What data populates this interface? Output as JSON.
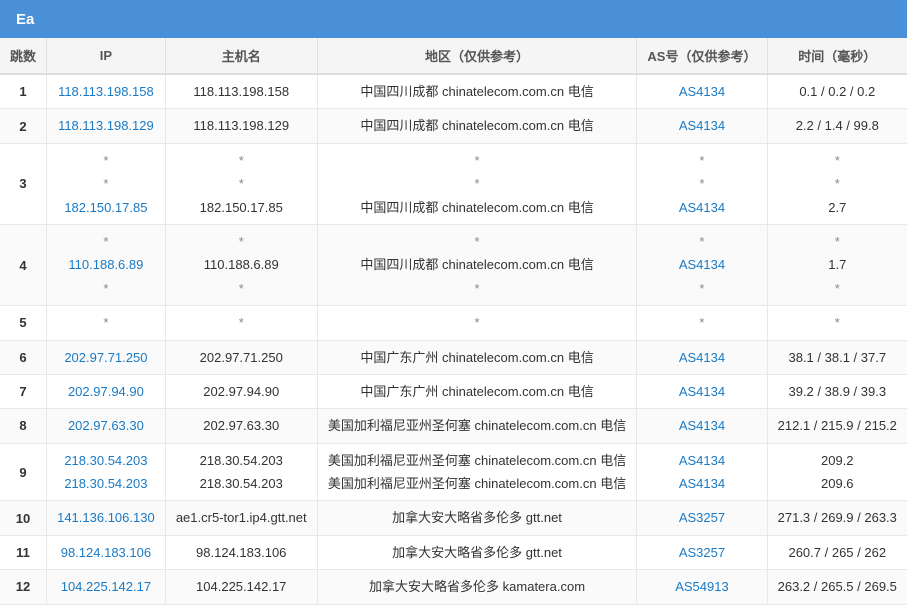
{
  "topbar": {
    "label": "Ea"
  },
  "table": {
    "headers": [
      "跳数",
      "IP",
      "主机名",
      "地区（仅供参考）",
      "AS号（仅供参考）",
      "时间（毫秒）"
    ],
    "rows": [
      {
        "hop": "1",
        "ips": [
          "118.113.198.158"
        ],
        "hostnames": [
          "118.113.198.158"
        ],
        "regions": [
          "中国四川成都 chinatelecom.com.cn 电信"
        ],
        "as": [
          "AS4134"
        ],
        "times": [
          "0.1 / 0.2 / 0.2"
        ]
      },
      {
        "hop": "2",
        "ips": [
          "118.113.198.129"
        ],
        "hostnames": [
          "118.113.198.129"
        ],
        "regions": [
          "中国四川成都 chinatelecom.com.cn 电信"
        ],
        "as": [
          "AS4134"
        ],
        "times": [
          "2.2 / 1.4 / 99.8"
        ]
      },
      {
        "hop": "3",
        "ips": [
          "*",
          "*",
          "182.150.17.85"
        ],
        "hostnames": [
          "*",
          "*",
          "182.150.17.85"
        ],
        "regions": [
          "*",
          "*",
          "中国四川成都 chinatelecom.com.cn 电信"
        ],
        "as": [
          "*",
          "*",
          "AS4134"
        ],
        "times": [
          "*",
          "*",
          "2.7"
        ]
      },
      {
        "hop": "4",
        "ips": [
          "*",
          "110.188.6.89",
          "*"
        ],
        "hostnames": [
          "*",
          "110.188.6.89",
          "*"
        ],
        "regions": [
          "*",
          "中国四川成都 chinatelecom.com.cn 电信",
          "*"
        ],
        "as": [
          "*",
          "AS4134",
          "*"
        ],
        "times": [
          "*",
          "1.7",
          "*"
        ]
      },
      {
        "hop": "5",
        "ips": [
          "*"
        ],
        "hostnames": [
          "*"
        ],
        "regions": [
          "*"
        ],
        "as": [
          "*"
        ],
        "times": [
          "*"
        ]
      },
      {
        "hop": "6",
        "ips": [
          "202.97.71.250"
        ],
        "hostnames": [
          "202.97.71.250"
        ],
        "regions": [
          "中国广东广州 chinatelecom.com.cn 电信"
        ],
        "as": [
          "AS4134"
        ],
        "times": [
          "38.1 / 38.1 / 37.7"
        ]
      },
      {
        "hop": "7",
        "ips": [
          "202.97.94.90"
        ],
        "hostnames": [
          "202.97.94.90"
        ],
        "regions": [
          "中国广东广州 chinatelecom.com.cn 电信"
        ],
        "as": [
          "AS4134"
        ],
        "times": [
          "39.2 / 38.9 / 39.3"
        ]
      },
      {
        "hop": "8",
        "ips": [
          "202.97.63.30"
        ],
        "hostnames": [
          "202.97.63.30"
        ],
        "regions": [
          "美国加利福尼亚州圣何塞 chinatelecom.com.cn 电信"
        ],
        "as": [
          "AS4134"
        ],
        "times": [
          "212.1 / 215.9 / 215.2"
        ]
      },
      {
        "hop": "9",
        "ips": [
          "218.30.54.203",
          "218.30.54.203"
        ],
        "hostnames": [
          "218.30.54.203",
          "218.30.54.203"
        ],
        "regions": [
          "美国加利福尼亚州圣何塞 chinatelecom.com.cn 电信",
          "美国加利福尼亚州圣何塞 chinatelecom.com.cn 电信"
        ],
        "as": [
          "AS4134",
          "AS4134"
        ],
        "times": [
          "209.2",
          "209.6"
        ]
      },
      {
        "hop": "10",
        "ips": [
          "141.136.106.130"
        ],
        "hostnames": [
          "ae1.cr5-tor1.ip4.gtt.net"
        ],
        "regions": [
          "加拿大安大略省多伦多 gtt.net"
        ],
        "as": [
          "AS3257"
        ],
        "times": [
          "271.3 / 269.9 / 263.3"
        ]
      },
      {
        "hop": "11",
        "ips": [
          "98.124.183.106"
        ],
        "hostnames": [
          "98.124.183.106"
        ],
        "regions": [
          "加拿大安大略省多伦多 gtt.net"
        ],
        "as": [
          "AS3257"
        ],
        "times": [
          "260.7 / 265 / 262"
        ]
      },
      {
        "hop": "12",
        "ips": [
          "104.225.142.17"
        ],
        "hostnames": [
          "104.225.142.17"
        ],
        "regions": [
          "加拿大安大略省多伦多 kamatera.com"
        ],
        "as": [
          "AS54913"
        ],
        "times": [
          "263.2 / 265.5 / 269.5"
        ]
      }
    ]
  }
}
